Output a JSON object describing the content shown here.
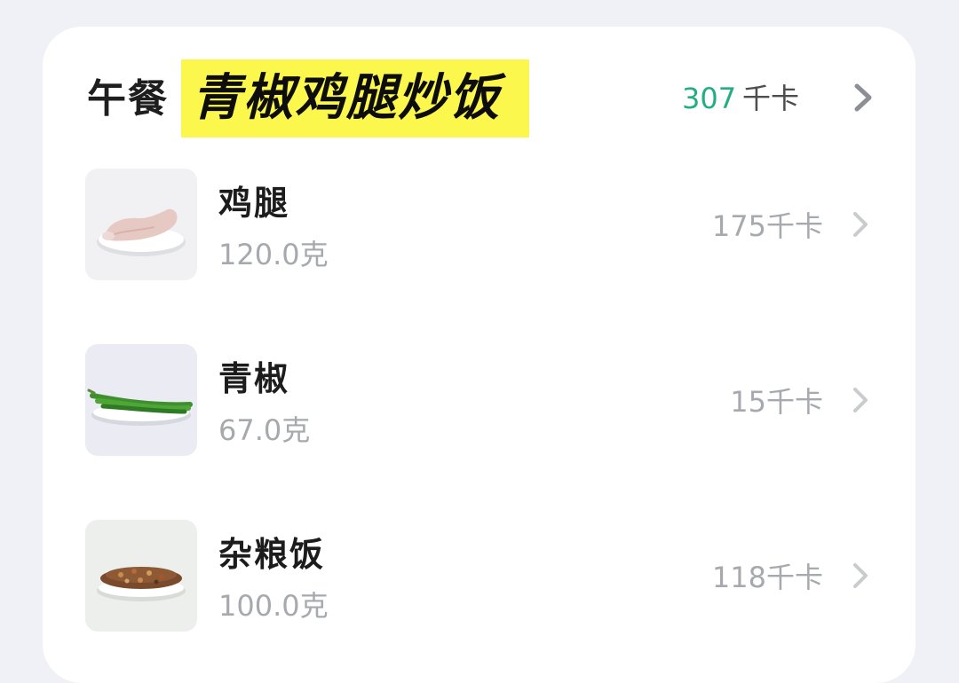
{
  "meal": {
    "label": "午餐",
    "dish_name": "青椒鸡腿炒饭",
    "total_kcal": "307",
    "total_unit": "千卡",
    "highlight_color": "#fbf74c",
    "accent_color": "#23ad82"
  },
  "items": [
    {
      "name": "鸡腿",
      "weight": "120.0克",
      "kcal": "175千卡",
      "image": "chicken-leg-on-plate"
    },
    {
      "name": "青椒",
      "weight": "67.0克",
      "kcal": "15千卡",
      "image": "green-peppers-on-plate"
    },
    {
      "name": "杂粮饭",
      "weight": "100.0克",
      "kcal": "118千卡",
      "image": "mixed-grain-rice-on-plate"
    }
  ],
  "icons": {
    "chevron": "chevron-right-icon"
  }
}
